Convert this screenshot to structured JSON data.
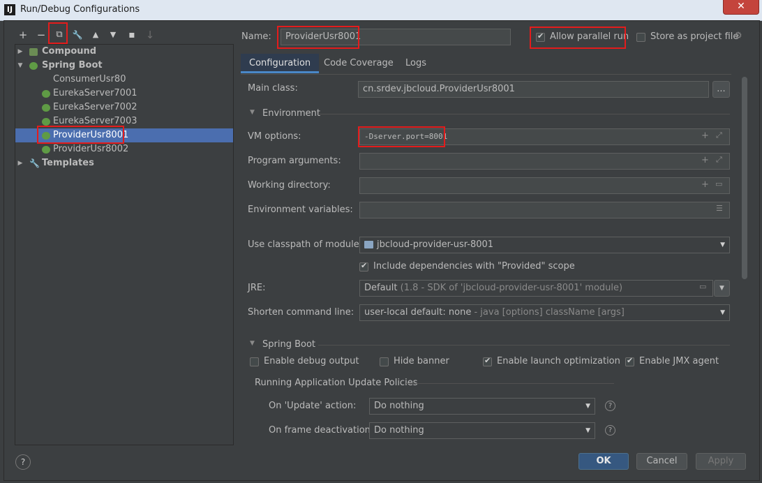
{
  "window": {
    "title": "Run/Debug Configurations",
    "app_icon": "IJ",
    "close_glyph": "✕"
  },
  "toolbar": {
    "items": [
      {
        "name": "add-config-button",
        "glyph": "+"
      },
      {
        "name": "remove-config-button",
        "glyph": "−"
      },
      {
        "name": "copy-config-button",
        "glyph": "⧉"
      },
      {
        "name": "edit-defaults-button",
        "glyph": "🔧"
      },
      {
        "name": "move-up-button",
        "glyph": "▲"
      },
      {
        "name": "move-down-button",
        "glyph": "▼"
      },
      {
        "name": "new-folder-button",
        "glyph": "▪"
      },
      {
        "name": "sort-button",
        "glyph": "↓"
      }
    ]
  },
  "tree": {
    "compound": "Compound",
    "spring_boot": "Spring Boot",
    "items": [
      "ConsumerUsr80",
      "EurekaServer7001",
      "EurekaServer7002",
      "EurekaServer7003",
      "ProviderUsr8001",
      "ProviderUsr8002"
    ],
    "templates": "Templates"
  },
  "header": {
    "name_label": "Name:",
    "name_value": "ProviderUsr8001",
    "allow_parallel": "Allow parallel run",
    "allow_parallel_checked": true,
    "store_project": "Store as project file",
    "store_project_checked": false
  },
  "tabs": [
    "Configuration",
    "Code Coverage",
    "Logs"
  ],
  "config": {
    "main_class_label": "Main class:",
    "main_class_value": "cn.srdev.jbcloud.ProviderUsr8001",
    "browse_label": "...",
    "environment_section": "Environment",
    "vm_options_label": "VM options:",
    "vm_options_value": "-Dserver.port=8001",
    "program_args_label": "Program arguments:",
    "working_dir_label": "Working directory:",
    "env_vars_label": "Environment variables:",
    "classpath_label": "Use classpath of module:",
    "classpath_value": "jbcloud-provider-usr-8001",
    "include_deps": "Include dependencies with \"Provided\" scope",
    "include_deps_checked": true,
    "jre_label": "JRE:",
    "jre_value": "Default",
    "jre_hint": "(1.8 - SDK of 'jbcloud-provider-usr-8001' module)",
    "shorten_label": "Shorten command line:",
    "shorten_value": "user-local default: none",
    "shorten_hint": "- java [options] className [args]"
  },
  "spring_boot": {
    "section": "Spring Boot",
    "enable_debug": "Enable debug output",
    "enable_debug_checked": false,
    "hide_banner": "Hide banner",
    "hide_banner_checked": false,
    "launch_opt": "Enable launch optimization",
    "launch_opt_checked": true,
    "jmx": "Enable JMX agent",
    "jmx_checked": true,
    "policies_title": "Running Application Update Policies",
    "update_action_label": "On 'Update' action:",
    "update_action_value": "Do nothing",
    "frame_deactivation_label": "On frame deactivation:",
    "frame_deactivation_value": "Do nothing"
  },
  "footer": {
    "help": "?",
    "ok": "OK",
    "cancel": "Cancel",
    "apply": "Apply"
  },
  "colors": {
    "accent": "#4b6eaf",
    "highlight": "#e31c1c",
    "background": "#3c3f41"
  }
}
